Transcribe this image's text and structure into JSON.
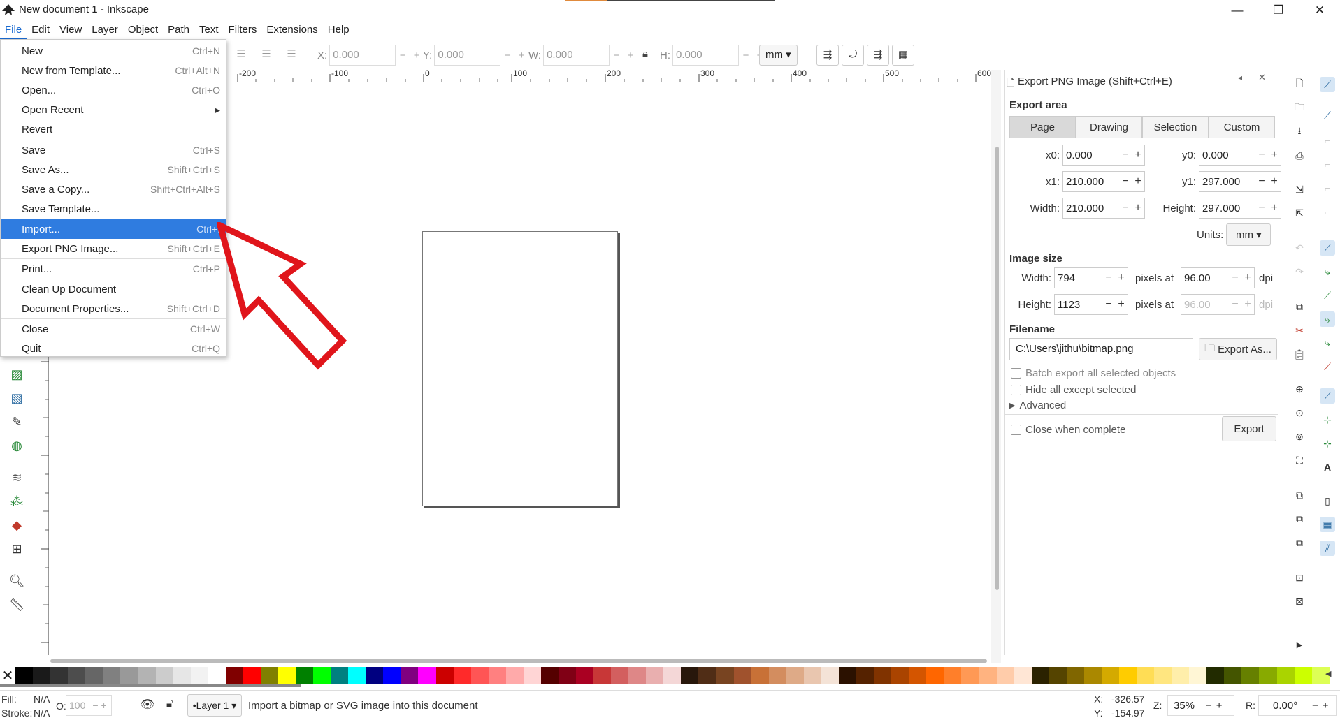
{
  "window": {
    "title": "New document 1 - Inkscape",
    "minimize": "—",
    "restore": "❐",
    "close": "✕"
  },
  "menubar": [
    "File",
    "Edit",
    "View",
    "Layer",
    "Object",
    "Path",
    "Text",
    "Filters",
    "Extensions",
    "Help"
  ],
  "toolbar": {
    "x_label": "X:",
    "x_value": "0.000",
    "y_label": "Y:",
    "y_value": "0.000",
    "w_label": "W:",
    "w_value": "0.000",
    "h_label": "H:",
    "h_value": "0.000",
    "units": "mm"
  },
  "ruler": [
    "-200",
    "-100",
    "0",
    "100",
    "200",
    "300",
    "400",
    "500",
    "600"
  ],
  "file_menu": [
    {
      "label": "New",
      "shortcut": "Ctrl+N"
    },
    {
      "label": "New from Template...",
      "shortcut": "Ctrl+Alt+N"
    },
    {
      "label": "Open...",
      "shortcut": "Ctrl+O"
    },
    {
      "label": "Open Recent",
      "shortcut": "▸"
    },
    {
      "label": "Revert",
      "shortcut": ""
    },
    {
      "label": "Save",
      "shortcut": "Ctrl+S"
    },
    {
      "label": "Save As...",
      "shortcut": "Shift+Ctrl+S"
    },
    {
      "label": "Save a Copy...",
      "shortcut": "Shift+Ctrl+Alt+S"
    },
    {
      "label": "Save Template...",
      "shortcut": ""
    },
    {
      "label": "Import...",
      "shortcut": "Ctrl+I"
    },
    {
      "label": "Export PNG Image...",
      "shortcut": "Shift+Ctrl+E"
    },
    {
      "label": "Print...",
      "shortcut": "Ctrl+P"
    },
    {
      "label": "Clean Up Document",
      "shortcut": ""
    },
    {
      "label": "Document Properties...",
      "shortcut": "Shift+Ctrl+D"
    },
    {
      "label": "Close",
      "shortcut": "Ctrl+W"
    },
    {
      "label": "Quit",
      "shortcut": "Ctrl+Q"
    }
  ],
  "export": {
    "title": "Export PNG Image (Shift+Ctrl+E)",
    "area_heading": "Export area",
    "area_tabs": [
      "Page",
      "Drawing",
      "Selection",
      "Custom"
    ],
    "x0_label": "x0:",
    "x0": "0.000",
    "y0_label": "y0:",
    "y0": "0.000",
    "x1_label": "x1:",
    "x1": "210.000",
    "y1_label": "y1:",
    "y1": "297.000",
    "width_label": "Width:",
    "width": "210.000",
    "height_label": "Height:",
    "height": "297.000",
    "units_label": "Units:",
    "units": "mm",
    "size_heading": "Image size",
    "img_width_label": "Width:",
    "img_width": "794",
    "img_height_label": "Height:",
    "img_height": "1123",
    "pixels_at": "pixels at",
    "dpi1": "96.00",
    "dpi2": "96.00",
    "dpi_label": "dpi",
    "filename_heading": "Filename",
    "filename": "C:\\Users\\jithu\\bitmap.png",
    "export_as": "Export As...",
    "batch": "Batch export all selected objects",
    "hide": "Hide all except selected",
    "advanced": "Advanced",
    "close_when_complete": "Close when complete",
    "export_btn": "Export"
  },
  "status": {
    "fill_label": "Fill:",
    "fill": "N/A",
    "stroke_label": "Stroke:",
    "stroke": "N/A",
    "o_label": "O:",
    "opacity": "100",
    "layer": "•Layer 1",
    "message": "Import a bitmap or SVG image into this document",
    "x_label": "X:",
    "x": "-326.57",
    "y_label": "Y:",
    "y": "-154.97",
    "z_label": "Z:",
    "zoom": "35%",
    "r_label": "R:",
    "rotation": "0.00°"
  },
  "palette": [
    "#000000",
    "#1a1a1a",
    "#333333",
    "#4d4d4d",
    "#666666",
    "#808080",
    "#999999",
    "#b3b3b3",
    "#cccccc",
    "#e6e6e6",
    "#f2f2f2",
    "#ffffff",
    "#800000",
    "#ff0000",
    "#808000",
    "#ffff00",
    "#008000",
    "#00ff00",
    "#008080",
    "#00ffff",
    "#000080",
    "#0000ff",
    "#800080",
    "#ff00ff",
    "#cc0000",
    "#ff2a2a",
    "#ff5555",
    "#ff8080",
    "#ffaaaa",
    "#ffd5d5",
    "#550000",
    "#800015",
    "#aa0022",
    "#c83737",
    "#d35f5f",
    "#de8787",
    "#e9afaf",
    "#f4d7d7",
    "#28170b",
    "#502d16",
    "#784421",
    "#a0522d",
    "#c87137",
    "#d38d5f",
    "#deaa87",
    "#e9c6af",
    "#f4e3d7",
    "#2b1100",
    "#552200",
    "#803300",
    "#aa4400",
    "#d45500",
    "#ff6600",
    "#ff7f2a",
    "#ff9955",
    "#ffb380",
    "#ffccaa",
    "#ffe6d5",
    "#2b2200",
    "#554400",
    "#806600",
    "#aa8800",
    "#d4aa00",
    "#ffcc00",
    "#ffdd55",
    "#ffe680",
    "#ffeeaa",
    "#fff6d5",
    "#222b00",
    "#445500",
    "#668000",
    "#88aa00",
    "#aad400",
    "#ccff00",
    "#ddff55"
  ]
}
